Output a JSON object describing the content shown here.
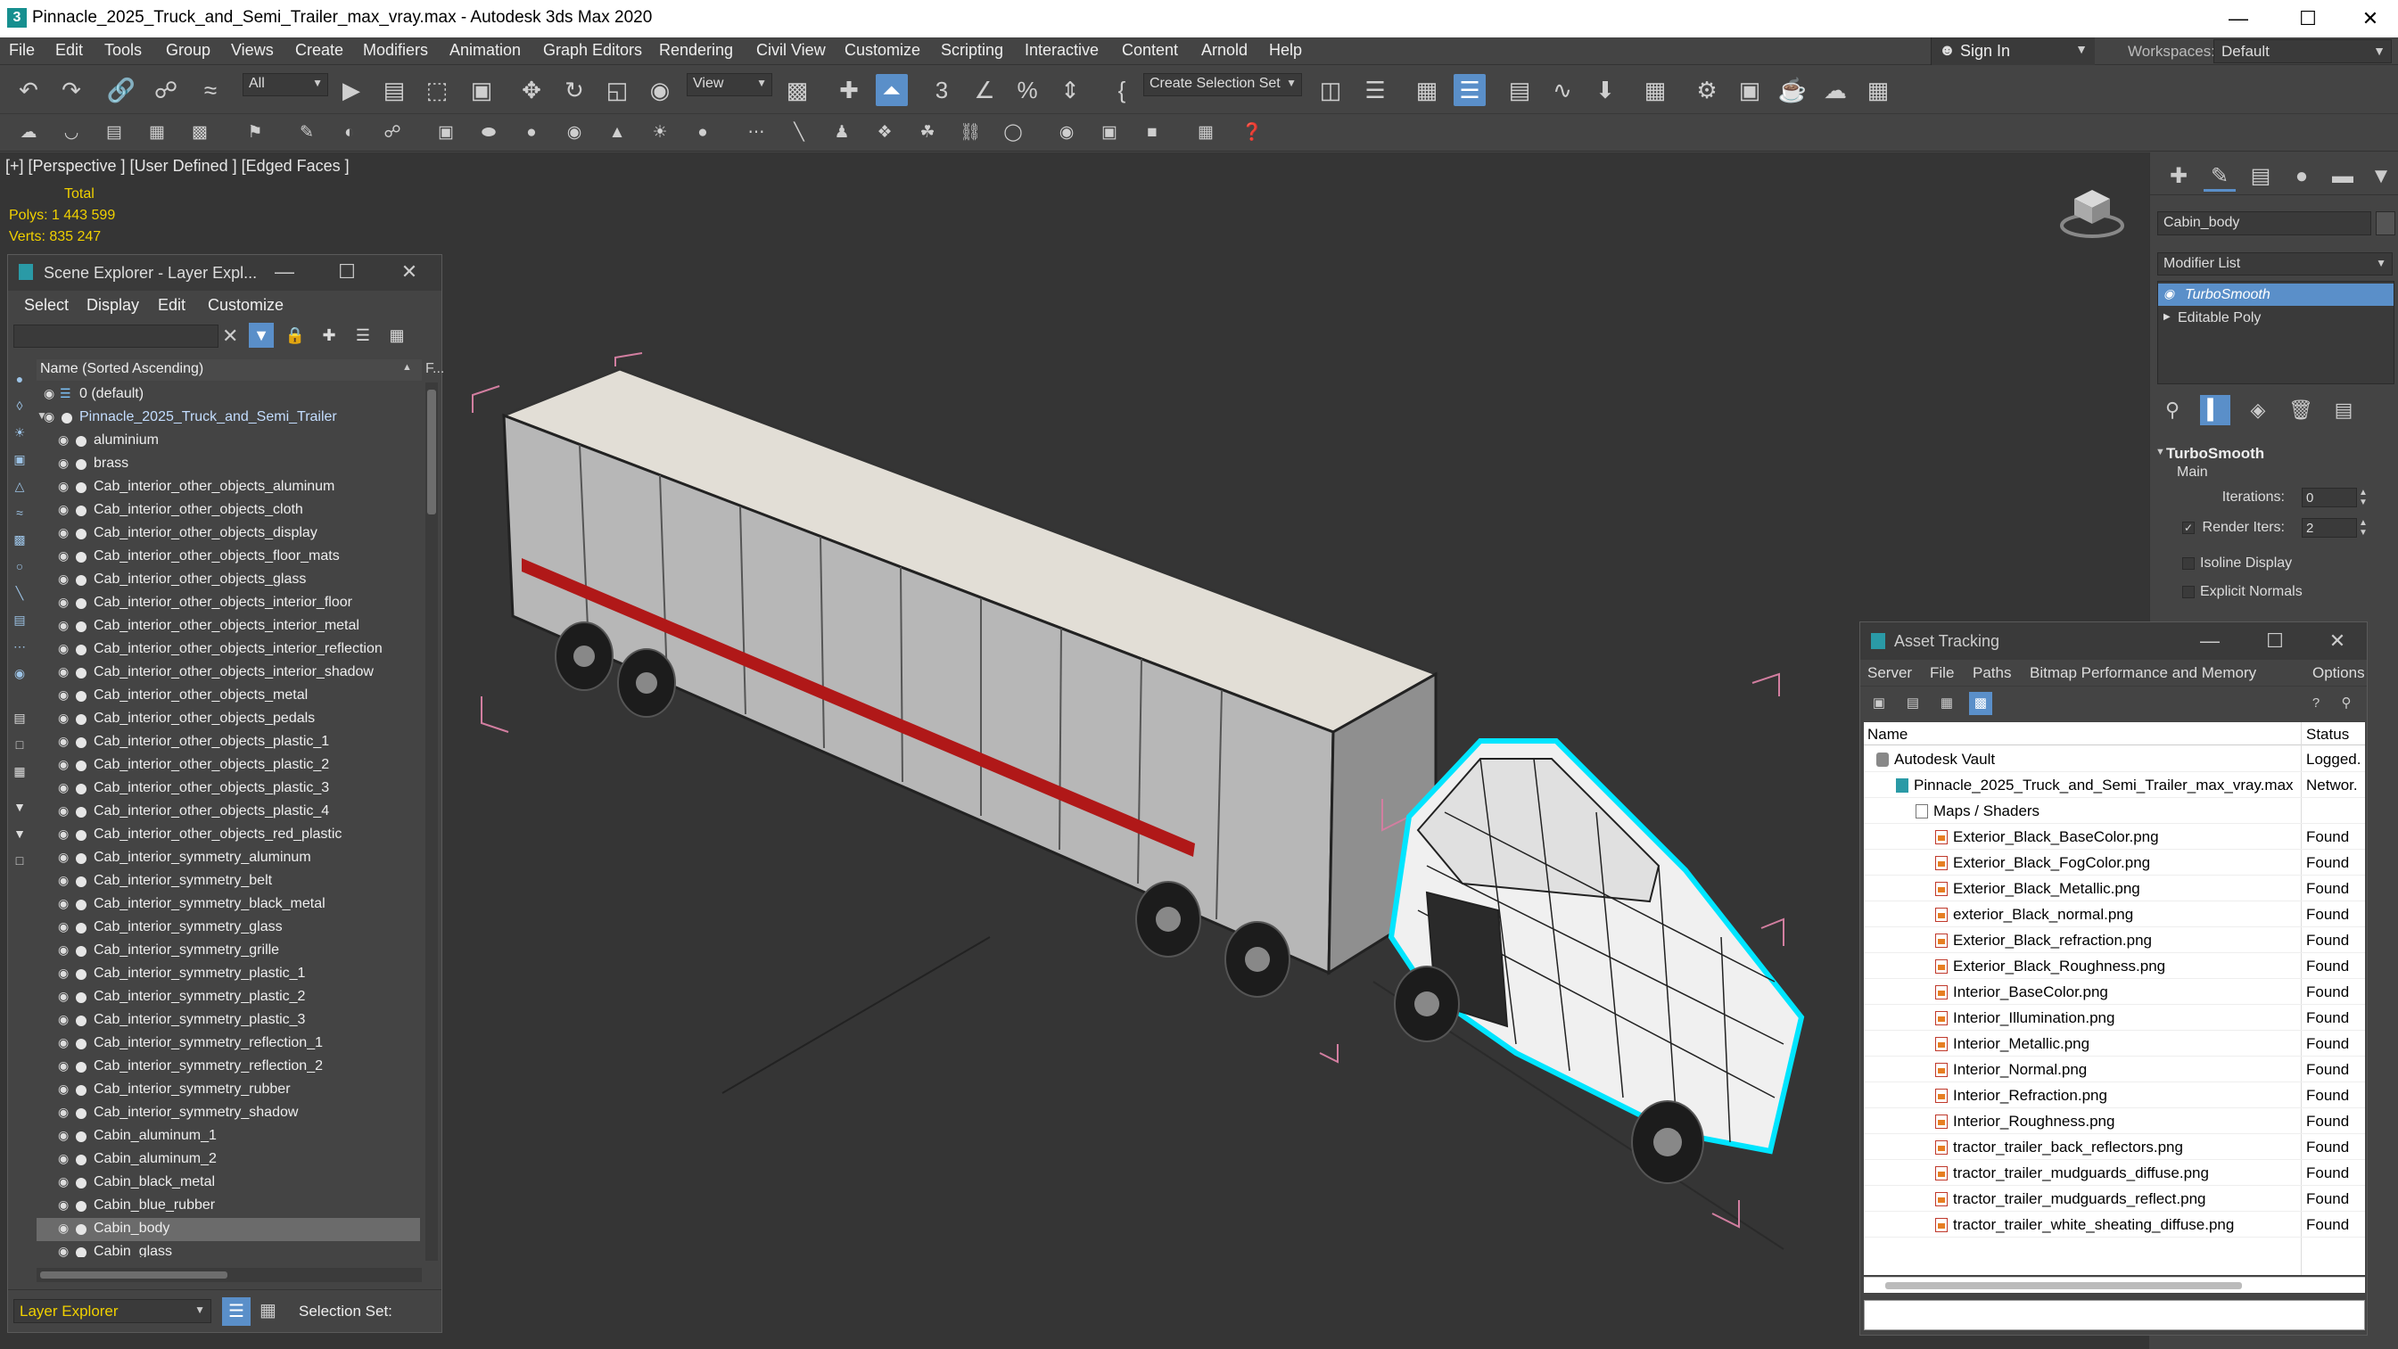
{
  "window": {
    "title": "Pinnacle_2025_Truck_and_Semi_Trailer_max_vray.max - Autodesk 3ds Max 2020",
    "minimize": "—",
    "maximize": "☐",
    "close": "✕"
  },
  "menu": [
    "File",
    "Edit",
    "Tools",
    "Group",
    "Views",
    "Create",
    "Modifiers",
    "Animation",
    "Graph Editors",
    "Rendering",
    "Civil View",
    "Customize",
    "Scripting",
    "Interactive",
    "Content",
    "Arnold",
    "Help"
  ],
  "signin": {
    "label": "Sign In"
  },
  "workspaces": {
    "label": "Workspaces:",
    "value": "Default"
  },
  "toolbar": {
    "filter_value": "All",
    "coord_value": "View",
    "selection_set_placeholder": "Create Selection Set"
  },
  "viewport": {
    "label": "[+] [Perspective ] [User Defined ] [Edged Faces ]",
    "stats": {
      "total_label": "Total",
      "polys_label": "Polys:",
      "polys_value": "1 443 599",
      "verts_label": "Verts:",
      "verts_value": "835 247"
    }
  },
  "scene_explorer": {
    "title": "Scene Explorer - Layer Expl...",
    "menu": [
      "Select",
      "Display",
      "Edit",
      "Customize"
    ],
    "header": "Name (Sorted Ascending)",
    "header_extra": "F...",
    "rows": [
      {
        "name": "0 (default)",
        "level": 0,
        "type": "layer"
      },
      {
        "name": "Pinnacle_2025_Truck_and_Semi_Trailer",
        "level": 0,
        "type": "parent"
      },
      {
        "name": "aluminium",
        "level": 1
      },
      {
        "name": "brass",
        "level": 1
      },
      {
        "name": "Cab_interior_other_objects_aluminum",
        "level": 1
      },
      {
        "name": "Cab_interior_other_objects_cloth",
        "level": 1
      },
      {
        "name": "Cab_interior_other_objects_display",
        "level": 1
      },
      {
        "name": "Cab_interior_other_objects_floor_mats",
        "level": 1
      },
      {
        "name": "Cab_interior_other_objects_glass",
        "level": 1
      },
      {
        "name": "Cab_interior_other_objects_interior_floor",
        "level": 1
      },
      {
        "name": "Cab_interior_other_objects_interior_metal",
        "level": 1
      },
      {
        "name": "Cab_interior_other_objects_interior_reflection",
        "level": 1
      },
      {
        "name": "Cab_interior_other_objects_interior_shadow",
        "level": 1
      },
      {
        "name": "Cab_interior_other_objects_metal",
        "level": 1
      },
      {
        "name": "Cab_interior_other_objects_pedals",
        "level": 1
      },
      {
        "name": "Cab_interior_other_objects_plastic_1",
        "level": 1
      },
      {
        "name": "Cab_interior_other_objects_plastic_2",
        "level": 1
      },
      {
        "name": "Cab_interior_other_objects_plastic_3",
        "level": 1
      },
      {
        "name": "Cab_interior_other_objects_plastic_4",
        "level": 1
      },
      {
        "name": "Cab_interior_other_objects_red_plastic",
        "level": 1
      },
      {
        "name": "Cab_interior_symmetry_aluminum",
        "level": 1
      },
      {
        "name": "Cab_interior_symmetry_belt",
        "level": 1
      },
      {
        "name": "Cab_interior_symmetry_black_metal",
        "level": 1
      },
      {
        "name": "Cab_interior_symmetry_glass",
        "level": 1
      },
      {
        "name": "Cab_interior_symmetry_grille",
        "level": 1
      },
      {
        "name": "Cab_interior_symmetry_plastic_1",
        "level": 1
      },
      {
        "name": "Cab_interior_symmetry_plastic_2",
        "level": 1
      },
      {
        "name": "Cab_interior_symmetry_plastic_3",
        "level": 1
      },
      {
        "name": "Cab_interior_symmetry_reflection_1",
        "level": 1
      },
      {
        "name": "Cab_interior_symmetry_reflection_2",
        "level": 1
      },
      {
        "name": "Cab_interior_symmetry_rubber",
        "level": 1
      },
      {
        "name": "Cab_interior_symmetry_shadow",
        "level": 1
      },
      {
        "name": "Cabin_aluminum_1",
        "level": 1
      },
      {
        "name": "Cabin_aluminum_2",
        "level": 1
      },
      {
        "name": "Cabin_black_metal",
        "level": 1
      },
      {
        "name": "Cabin_blue_rubber",
        "level": 1
      },
      {
        "name": "Cabin_body",
        "level": 1,
        "selected": true
      },
      {
        "name": "Cabin_glass",
        "level": 1
      }
    ],
    "mode": "Layer Explorer",
    "selection_set_label": "Selection Set:"
  },
  "command_panel": {
    "object_name": "Cabin_body",
    "modifier_list": "Modifier List",
    "stack": [
      "TurboSmooth",
      "Editable Poly"
    ],
    "rollout_title": "TurboSmooth",
    "main_label": "Main",
    "iterations_label": "Iterations:",
    "iterations_value": "0",
    "render_iters_label": "Render Iters:",
    "render_iters_value": "2",
    "isoline_label": "Isoline Display",
    "explicit_normals_label": "Explicit Normals"
  },
  "asset_tracking": {
    "title": "Asset Tracking",
    "menu": [
      "Server",
      "File",
      "Paths",
      "Bitmap Performance and Memory",
      "Options"
    ],
    "col_name": "Name",
    "col_status": "Status",
    "rows": [
      {
        "name": "Autodesk Vault",
        "status": "Logged.",
        "indent": 0,
        "icon": "vault"
      },
      {
        "name": "Pinnacle_2025_Truck_and_Semi_Trailer_max_vray.max",
        "status": "Networ.",
        "indent": 1,
        "icon": "max"
      },
      {
        "name": "Maps / Shaders",
        "status": "",
        "indent": 2,
        "icon": "folder"
      },
      {
        "name": "Exterior_Black_BaseColor.png",
        "status": "Found",
        "indent": 3,
        "icon": "img"
      },
      {
        "name": "Exterior_Black_FogColor.png",
        "status": "Found",
        "indent": 3,
        "icon": "img"
      },
      {
        "name": "Exterior_Black_Metallic.png",
        "status": "Found",
        "indent": 3,
        "icon": "img"
      },
      {
        "name": "exterior_Black_normal.png",
        "status": "Found",
        "indent": 3,
        "icon": "img"
      },
      {
        "name": "Exterior_Black_refraction.png",
        "status": "Found",
        "indent": 3,
        "icon": "img"
      },
      {
        "name": "Exterior_Black_Roughness.png",
        "status": "Found",
        "indent": 3,
        "icon": "img"
      },
      {
        "name": "Interior_BaseColor.png",
        "status": "Found",
        "indent": 3,
        "icon": "img"
      },
      {
        "name": "Interior_Illumination.png",
        "status": "Found",
        "indent": 3,
        "icon": "img"
      },
      {
        "name": "Interior_Metallic.png",
        "status": "Found",
        "indent": 3,
        "icon": "img"
      },
      {
        "name": "Interior_Normal.png",
        "status": "Found",
        "indent": 3,
        "icon": "img"
      },
      {
        "name": "Interior_Refraction.png",
        "status": "Found",
        "indent": 3,
        "icon": "img"
      },
      {
        "name": "Interior_Roughness.png",
        "status": "Found",
        "indent": 3,
        "icon": "img"
      },
      {
        "name": "tractor_trailer_back_reflectors.png",
        "status": "Found",
        "indent": 3,
        "icon": "img"
      },
      {
        "name": "tractor_trailer_mudguards_diffuse.png",
        "status": "Found",
        "indent": 3,
        "icon": "img"
      },
      {
        "name": "tractor_trailer_mudguards_reflect.png",
        "status": "Found",
        "indent": 3,
        "icon": "img"
      },
      {
        "name": "tractor_trailer_white_sheating_diffuse.png",
        "status": "Found",
        "indent": 3,
        "icon": "img"
      }
    ]
  },
  "colors": {
    "accent": "#5a8fc9",
    "stats_yellow": "#f0d000",
    "selection_cyan": "#00e5ff",
    "trailer_stripe": "#b01818",
    "bbox_pink": "#d27ea0"
  }
}
